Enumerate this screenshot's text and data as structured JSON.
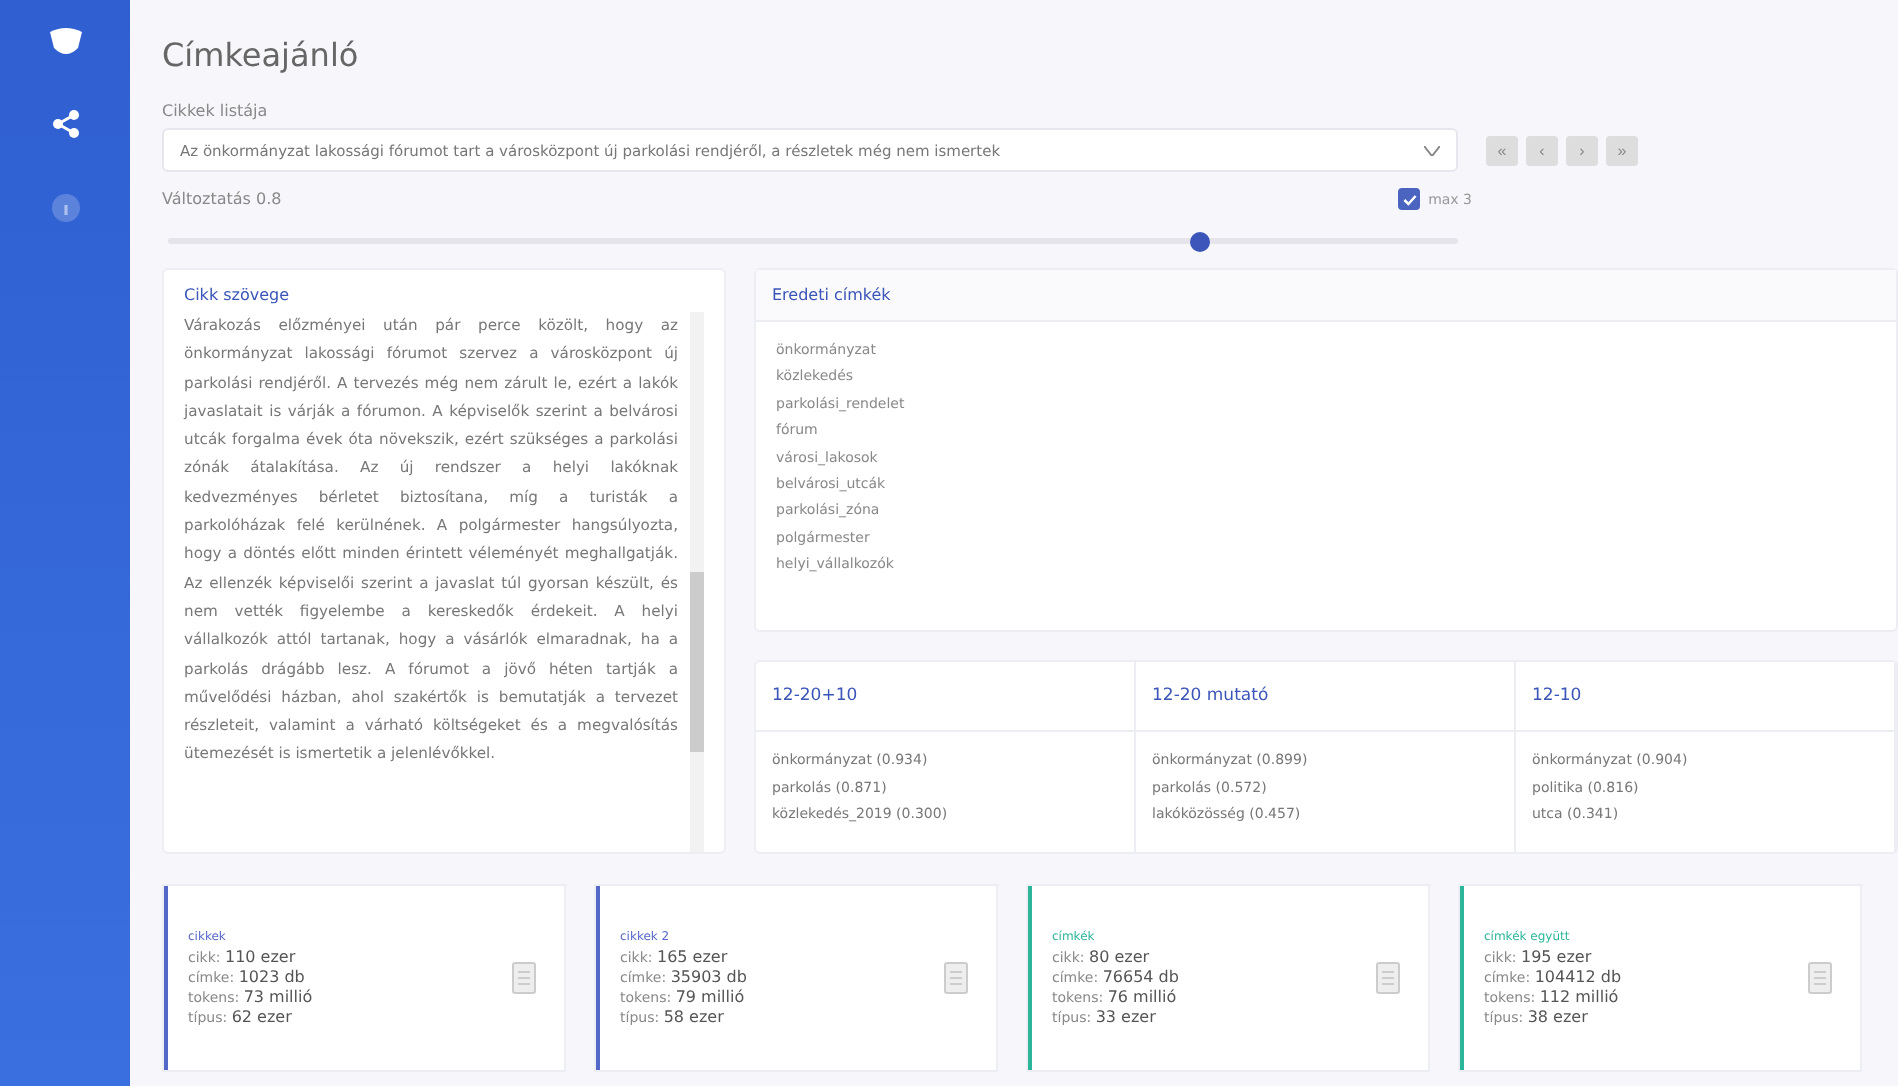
{
  "sidebar": {
    "items": [
      {
        "kind": "share",
        "selected": true
      },
      {
        "kind": "info",
        "selected": false
      }
    ]
  },
  "title": "Címkeajánló",
  "article_select": {
    "label": "Cikkek listája",
    "value": "Az önkormányzat lakossági fórumot tart a városközpont új parkolási rendjéről, a részletek még nem ismertek"
  },
  "pager_buttons": [
    "«",
    "‹",
    "›",
    "»"
  ],
  "threshold": {
    "label": "Változtatás 0.8",
    "level": 0.8
  },
  "max_option": {
    "label": "max 3",
    "checked": true
  },
  "article_panel": {
    "title": "Cikk szövege",
    "text": "Várakozás előzményei után pár perce közölt, hogy az önkormányzat lakossági fórumot szervez a városközpont új parkolási rendjéről. A tervezés még nem zárult le, ezért a lakók javaslatait is várják a fórumon. A képviselők szerint a belvárosi utcák forgalma évek óta növekszik, ezért szükséges a parkolási zónák átalakítása. Az új rendszer a helyi lakóknak kedvezményes bérletet biztosítana, míg a turisták a parkolóházak felé kerülnének. A polgármester hangsúlyozta, hogy a döntés előtt minden érintett véleményét meghallgatják. Az ellenzék képviselői szerint a javaslat túl gyorsan készült, és nem vették figyelembe a kereskedők érdekeit. A helyi vállalkozók attól tartanak, hogy a vásárlók elmaradnak, ha a parkolás drágább lesz. A fórumot a jövő héten tartják a művelődési házban, ahol szakértők is bemutatják a tervezet részleteit, valamint a várható költségeket és a megvalósítás ütemezését is ismertetik a jelenlévőkkel."
  },
  "original_tags": {
    "title": "Eredeti címkék",
    "tags": [
      "önkormányzat",
      "közlekedés",
      "parkolási_rendelet",
      "fórum",
      "városi_lakosok",
      "belvárosi_utcák",
      "parkolási_zóna",
      "polgármester",
      "helyi_vállalkozók"
    ]
  },
  "suggestions": [
    {
      "title": "12-20+10",
      "lines": [
        "önkormányzat (0.934)",
        "parkolás (0.871)",
        "közlekedés_2019 (0.300)"
      ]
    },
    {
      "title": "12-20 mutató",
      "lines": [
        "önkormányzat (0.899)",
        "parkolás (0.572)",
        "lakóközösség (0.457)"
      ]
    },
    {
      "title": "12-10",
      "lines": [
        "önkormányzat (0.904)",
        "politika (0.816)",
        "utca (0.341)"
      ]
    }
  ],
  "stats": [
    {
      "name": "cikkek",
      "color": "#5468c8",
      "lines": [
        {
          "label": "cikk:",
          "value": "110 ezer"
        },
        {
          "label": "címke:",
          "value": "1023 db"
        },
        {
          "label": "tokens:",
          "value": "73 millió"
        },
        {
          "label": "típus:",
          "value": "62 ezer"
        }
      ]
    },
    {
      "name": "cikkek 2",
      "color": "#5468c8",
      "lines": [
        {
          "label": "cikk:",
          "value": "165 ezer"
        },
        {
          "label": "címke:",
          "value": "35903 db"
        },
        {
          "label": "tokens:",
          "value": "79 millió"
        },
        {
          "label": "típus:",
          "value": "58 ezer"
        }
      ]
    },
    {
      "name": "címkék",
      "color": "#2bb59a",
      "lines": [
        {
          "label": "cikk:",
          "value": "80 ezer"
        },
        {
          "label": "címke:",
          "value": "76654 db"
        },
        {
          "label": "tokens:",
          "value": "76 millió"
        },
        {
          "label": "típus:",
          "value": "33 ezer"
        }
      ]
    },
    {
      "name": "címkék együtt",
      "color": "#2bb59a",
      "lines": [
        {
          "label": "cikk:",
          "value": "195 ezer"
        },
        {
          "label": "címke:",
          "value": "104412 db"
        },
        {
          "label": "tokens:",
          "value": "112 millió"
        },
        {
          "label": "típus:",
          "value": "38 ezer"
        }
      ]
    }
  ]
}
